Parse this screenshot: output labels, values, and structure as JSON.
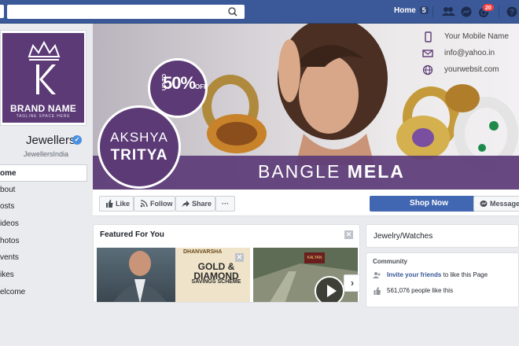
{
  "search": {
    "placeholder": "",
    "value": ""
  },
  "topnav": {
    "home_label": "Home",
    "home_count": "5",
    "notification_count": "20"
  },
  "profile": {
    "brand_name": "BRAND NAME",
    "tagline": "TAGLINE SPACE HERE",
    "page_name": "Jewellers",
    "handle": "JewellersIndia"
  },
  "sidebar": {
    "items": [
      {
        "label": "ome"
      },
      {
        "label": "bout"
      },
      {
        "label": "osts"
      },
      {
        "label": "ideos"
      },
      {
        "label": "hotos"
      },
      {
        "label": "vents"
      },
      {
        "label": "ikes"
      },
      {
        "label": "elcome"
      }
    ]
  },
  "cover": {
    "promo_upto": "UP TO",
    "promo_percent": "50%",
    "promo_off": "OFF",
    "akshya": "AKSHYA",
    "tritya": "TRITYA",
    "mela_light": "BANGLE ",
    "mela_bold": "MELA",
    "mobile": "Your Mobile Name",
    "email": "info@yahoo.in",
    "website": "yourwebsit.com"
  },
  "actions": {
    "like": "Like",
    "follow": "Follow",
    "share": "Share",
    "more": "···",
    "shop_now": "Shop Now",
    "message": "Message"
  },
  "featured": {
    "title": "Featured For You",
    "card1_brand": "DHANVARSHA",
    "card1_headline": "GOLD & DIAMOND",
    "card1_sub": "SAVINGS SCHEME",
    "card2_brand": "KALYAN"
  },
  "about": {
    "category": "Jewelry/Watches",
    "community_heading": "Community",
    "invite_link": "Invite your friends",
    "invite_rest": " to like this Page",
    "likes_text": "561,076 people like this"
  },
  "colors": {
    "facebook_blue": "#3b5998",
    "brand_purple": "#5b3a76",
    "shop_button": "#4267b2",
    "badge_red": "#fa3e3e"
  }
}
